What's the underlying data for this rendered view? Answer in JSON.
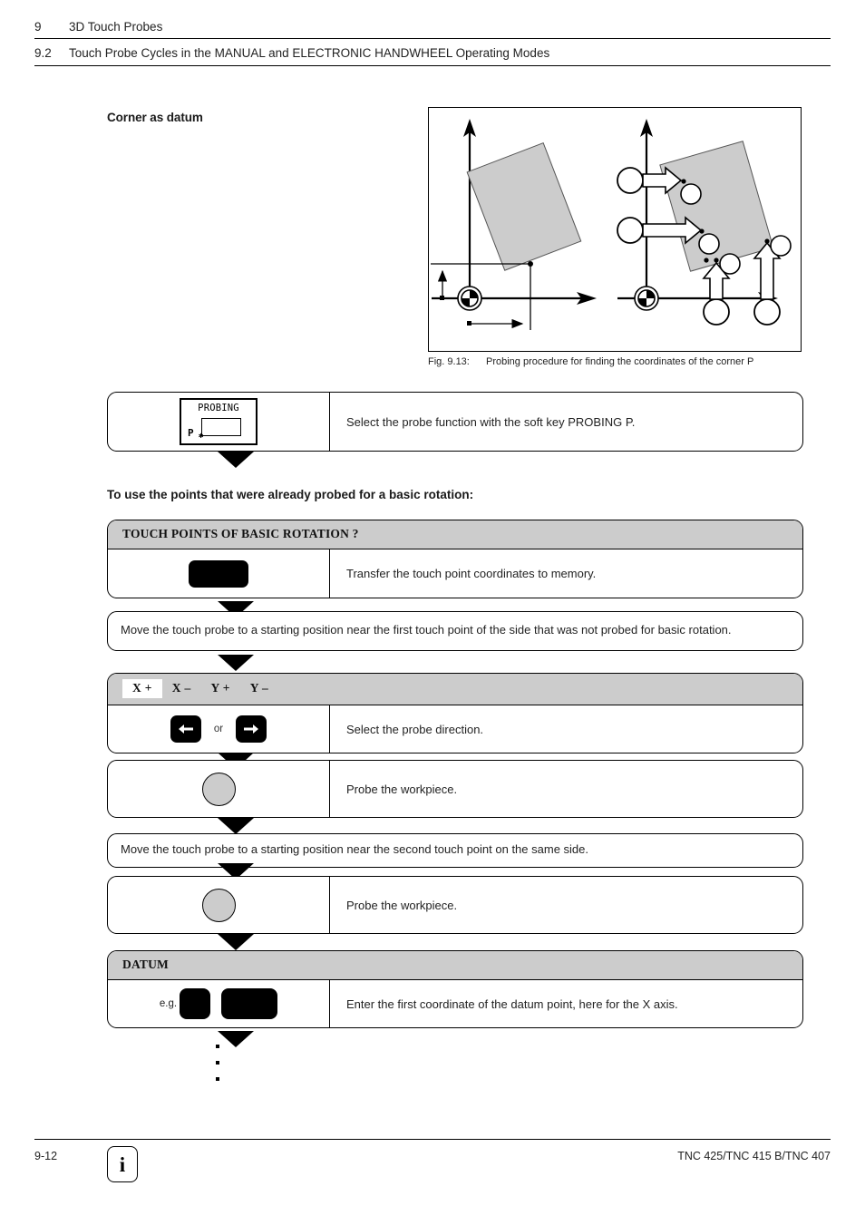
{
  "header": {
    "chapter_number": "9",
    "chapter_title": "3D Touch Probes",
    "section_number": "9.2",
    "section_title": "Touch Probe Cycles in the MANUAL and ELECTRONIC HANDWHEEL Operating Modes"
  },
  "section": {
    "title": "Corner as datum",
    "intro": "To use the points that were already probed for a basic rotation:"
  },
  "figure": {
    "label": "Fig. 9.13:",
    "caption": "Probing procedure for finding the coordinates of the corner P"
  },
  "probing_step": {
    "softkey_label": "PROBING",
    "softkey_p": "P",
    "text": "Select the probe function with the soft key PROBING P."
  },
  "steps": [
    {
      "kind": "titled",
      "title": "TOUCH POINTS OF BASIC ROTATION ?",
      "key": "blank-key",
      "text": "Transfer the touch point coordinates to memory."
    },
    {
      "kind": "text",
      "text": "Move the touch probe to a starting position near the first touch point of the side that was not probed for basic rotation."
    },
    {
      "kind": "axis",
      "axes": [
        "X +",
        "X –",
        "Y +",
        "Y –"
      ],
      "selected_index": 0,
      "or_label": "or",
      "key_left": "arrow-left-key",
      "key_right": "arrow-right-key",
      "text": "Select the probe direction."
    },
    {
      "kind": "circle",
      "key": "probe-start-button",
      "text": "Probe the workpiece."
    },
    {
      "kind": "text",
      "text": "Move the touch probe to a starting position near the second touch point on the same side."
    },
    {
      "kind": "circle",
      "key": "probe-start-button",
      "text": "Probe the workpiece."
    },
    {
      "kind": "titled",
      "title": "DATUM",
      "eg_label": "e.g.",
      "key_small": "numeric-key",
      "key_wide": "enter-key",
      "text": "Enter the first coordinate of the datum point, here for the X axis."
    }
  ],
  "footer": {
    "page_number": "9-12",
    "info_glyph": "i",
    "model": "TNC 425/TNC 415 B/TNC 407"
  },
  "colors": {
    "gray_fill": "#cccccc",
    "black": "#000000",
    "text": "#222222"
  }
}
